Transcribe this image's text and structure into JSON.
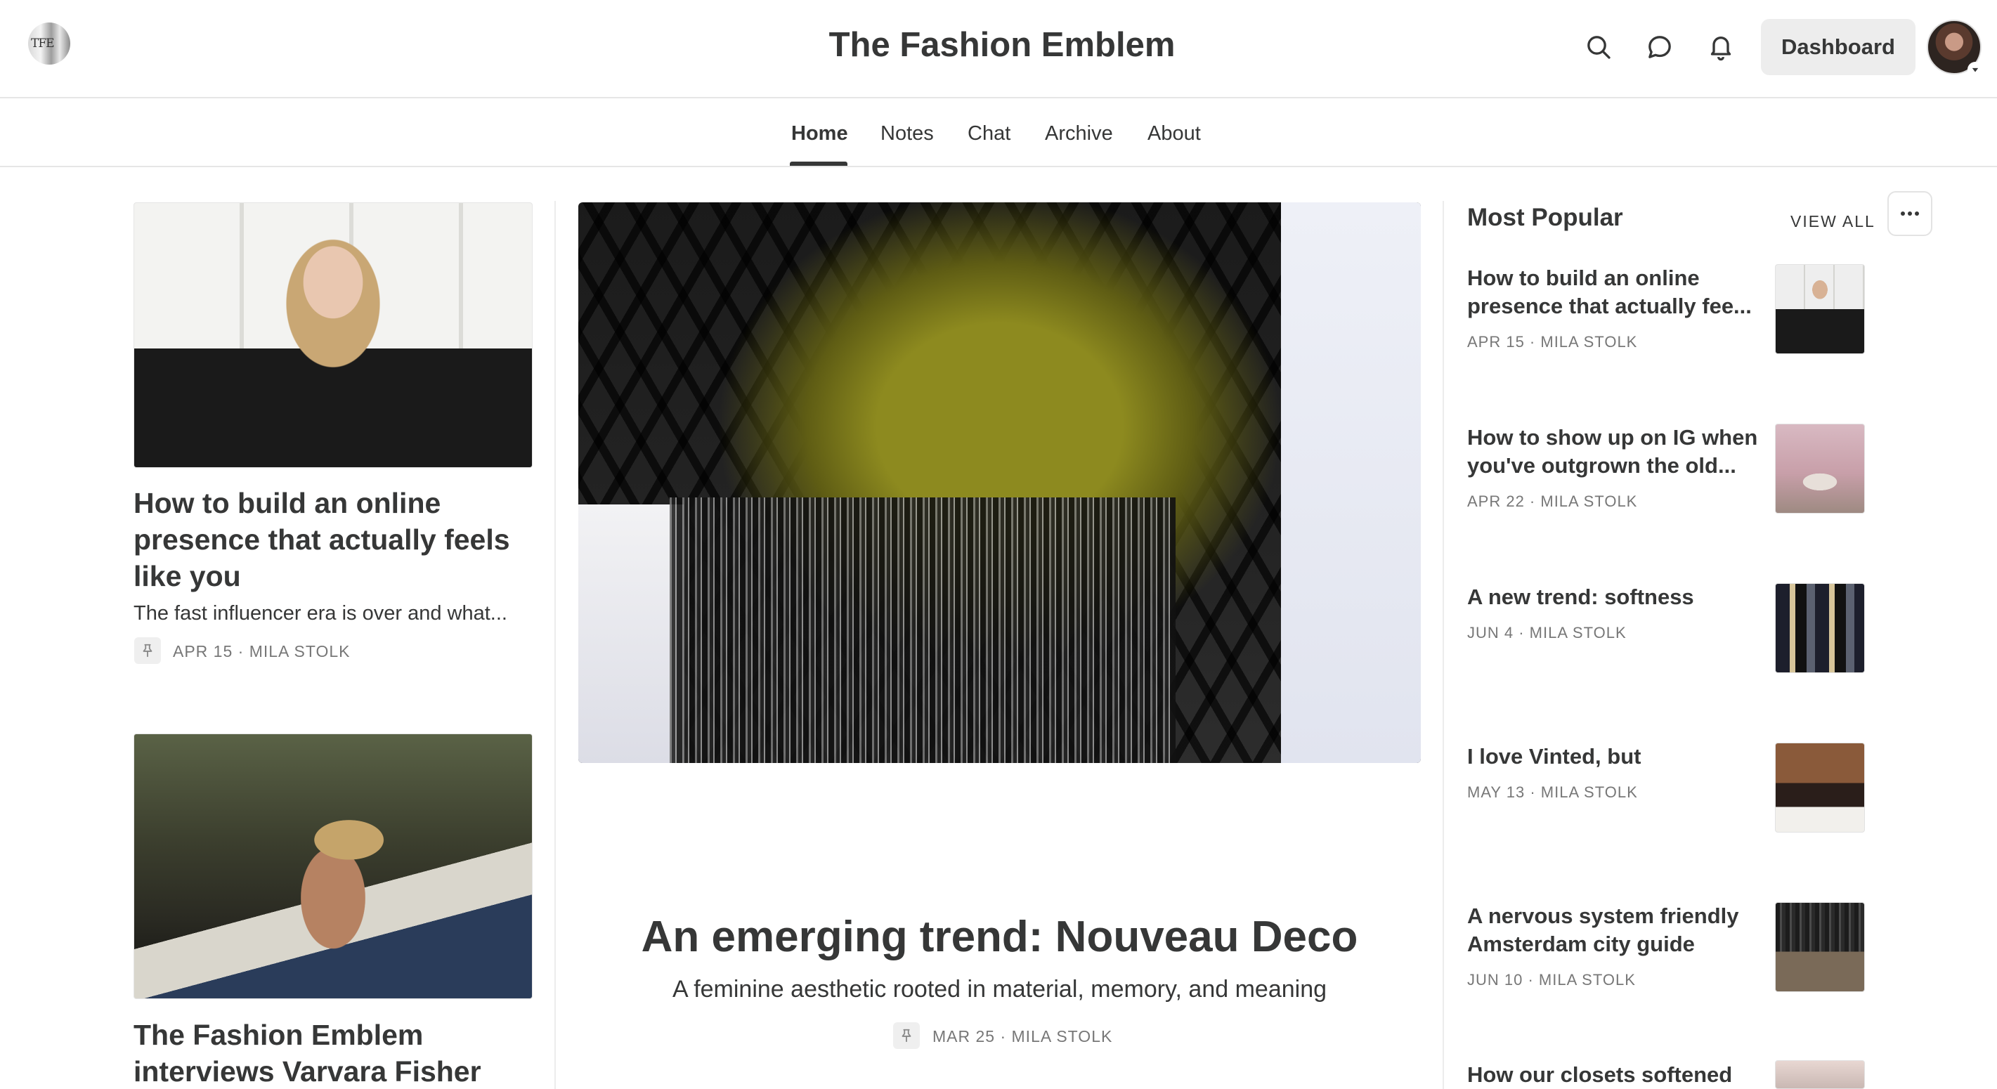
{
  "header": {
    "logo_text": "TFE",
    "site_title": "The Fashion Emblem",
    "dashboard_label": "Dashboard"
  },
  "nav": {
    "items": [
      {
        "label": "Home",
        "active": true
      },
      {
        "label": "Notes"
      },
      {
        "label": "Chat"
      },
      {
        "label": "Archive"
      },
      {
        "label": "About"
      }
    ]
  },
  "left_column": {
    "posts": [
      {
        "title": "How to build an online presence that actually feels like you",
        "subtitle": "The fast influencer era is over and what...",
        "meta": "APR 15 · MILA STOLK"
      },
      {
        "title": "The Fashion Emblem interviews Varvara Fisher"
      }
    ]
  },
  "featured": {
    "title": "An emerging trend: Nouveau Deco",
    "subtitle": "A feminine aesthetic rooted in material, memory, and meaning",
    "meta": "MAR 25 · MILA STOLK"
  },
  "most_popular": {
    "heading": "Most Popular",
    "view_all": "VIEW ALL",
    "items": [
      {
        "title": "How to build an online presence that actually fee...",
        "meta": "APR 15 · MILA STOLK"
      },
      {
        "title": "How to show up on IG when you've outgrown the old...",
        "meta": "APR 22 · MILA STOLK"
      },
      {
        "title": "A new trend: softness",
        "meta": "JUN 4 · MILA STOLK"
      },
      {
        "title": "I love Vinted, but",
        "meta": "MAY 13 · MILA STOLK"
      },
      {
        "title": "A nervous system friendly Amsterdam city guide",
        "meta": "JUN 10 · MILA STOLK"
      },
      {
        "title": "How our closets softened"
      }
    ]
  },
  "icons": {
    "search": "search-icon",
    "chat": "chat-bubble-icon",
    "notifications": "bell-icon",
    "pin": "pin-icon",
    "more": "more-icon"
  }
}
